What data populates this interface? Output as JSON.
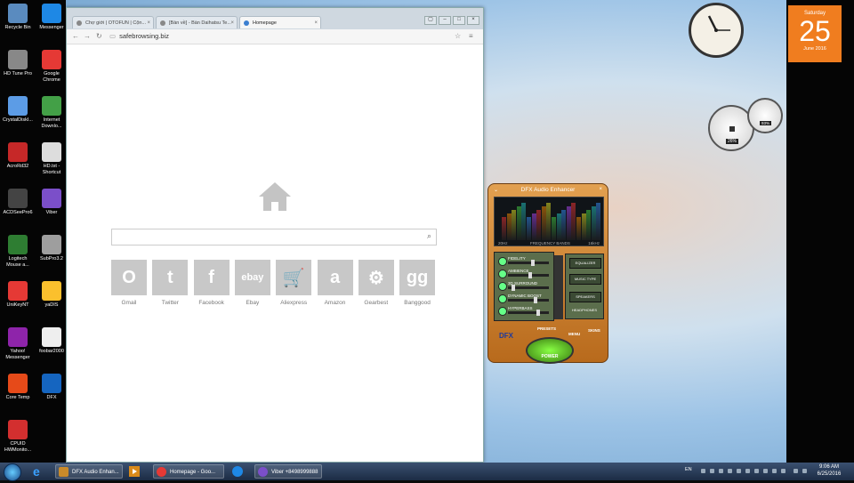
{
  "desktop": {
    "icons": [
      {
        "label": "Recycle Bin",
        "color": "#5a8bbf"
      },
      {
        "label": "Messenger",
        "color": "#1e88e5"
      },
      {
        "label": "HD Tune Pro",
        "color": "#888888"
      },
      {
        "label": "Google Chrome",
        "color": "#e53935"
      },
      {
        "label": "CrystalDiskI...",
        "color": "#5c9ce6"
      },
      {
        "label": "Internet Downlo...",
        "color": "#43a047"
      },
      {
        "label": "AcroRd32",
        "color": "#c62828"
      },
      {
        "label": "HD.txt - Shortcut",
        "color": "#dddddd"
      },
      {
        "label": "ACDSeePro6",
        "color": "#444444"
      },
      {
        "label": "Viber",
        "color": "#7b4fc9"
      },
      {
        "label": "Logitech Mouse a...",
        "color": "#2e7d32"
      },
      {
        "label": "SubPro3.2",
        "color": "#9e9e9e"
      },
      {
        "label": "UniKeyNT",
        "color": "#e53935"
      },
      {
        "label": "yaDIS",
        "color": "#fbc02d"
      },
      {
        "label": "Yahoo! Messenger",
        "color": "#8e24aa"
      },
      {
        "label": "foobar2000",
        "color": "#eeeeee"
      },
      {
        "label": "Core Temp",
        "color": "#e64a19"
      },
      {
        "label": "DFX",
        "color": "#1565c0"
      },
      {
        "label": "CPUID HWMonito...",
        "color": "#d32f2f"
      }
    ]
  },
  "browser": {
    "tabs": [
      {
        "label": "Chợ giới | OTOFUN | Cộn..."
      },
      {
        "label": "[Bàn về] - Bàn Daihatsu Te..."
      },
      {
        "label": "Homepage"
      }
    ],
    "url": "safebrowsing.biz",
    "search_placeholder": "",
    "tiles": [
      {
        "label": "Gmail",
        "glyph": "O"
      },
      {
        "label": "Twitter",
        "glyph": "t"
      },
      {
        "label": "Facebook",
        "glyph": "f"
      },
      {
        "label": "Ebay",
        "glyph": "ebay"
      },
      {
        "label": "Aliexpress",
        "glyph": "🛒"
      },
      {
        "label": "Amazon",
        "glyph": "a"
      },
      {
        "label": "Gearbest",
        "glyph": "⚙"
      },
      {
        "label": "Banggood",
        "glyph": "gg"
      }
    ]
  },
  "calendar": {
    "weekday": "Saturday",
    "day": "25",
    "month_year": "June 2016"
  },
  "meters": {
    "cpu": "26%",
    "mem": "93%"
  },
  "dfx": {
    "title": "DFX Audio Enhancer",
    "rows": [
      {
        "label": "FIDELITY",
        "level": 0.62
      },
      {
        "label": "AMBIENCE",
        "level": 0.55
      },
      {
        "label": "3D SURROUND",
        "level": 0.1
      },
      {
        "label": "DYNAMIC BOOST",
        "level": 0.68
      },
      {
        "label": "HYPERBASS",
        "level": 0.75
      }
    ],
    "side": [
      "EQUALIZER",
      "MUSIC TYPE",
      "SPEAKERS",
      "HEADPHONES"
    ],
    "presets": "PRESETS",
    "menu": "MENU",
    "skins": "SKINS",
    "power": "POWER",
    "logo": "DFX",
    "screen_left": "20Hz",
    "screen_mid": "FREQUENCY BANDS",
    "screen_right": "16kHz"
  },
  "taskbar": {
    "items": [
      {
        "label": "DFX Audio Enhan...",
        "color": "#c98a2a"
      },
      {
        "label": "Homepage - Goo...",
        "color": "#e53935"
      },
      {
        "label": "Viber +8498999888",
        "color": "#7b4fc9"
      }
    ],
    "lang": "EN",
    "time": "9:06 AM",
    "date": "6/25/2016"
  }
}
